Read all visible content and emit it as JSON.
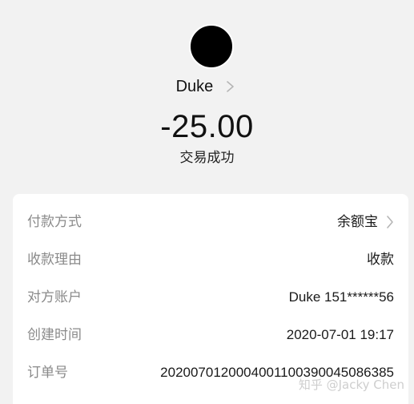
{
  "payee": {
    "name": "Duke"
  },
  "transaction": {
    "amount": "-25.00",
    "status": "交易成功"
  },
  "details": [
    {
      "label": "付款方式",
      "value": "余额宝",
      "has_chevron": true
    },
    {
      "label": "收款理由",
      "value": "收款",
      "has_chevron": false
    },
    {
      "label": "对方账户",
      "value": "Duke 151******56",
      "has_chevron": false
    },
    {
      "label": "创建时间",
      "value": "2020-07-01 19:17",
      "has_chevron": false
    },
    {
      "label": "订单号",
      "value": "2020070120004001100390045086385",
      "has_chevron": false
    }
  ],
  "watermark": "知乎 @Jacky Chen",
  "colors": {
    "background": "#f2f2f2",
    "card": "#ffffff",
    "label": "#8a8a8a",
    "text": "#1a1a1a"
  }
}
